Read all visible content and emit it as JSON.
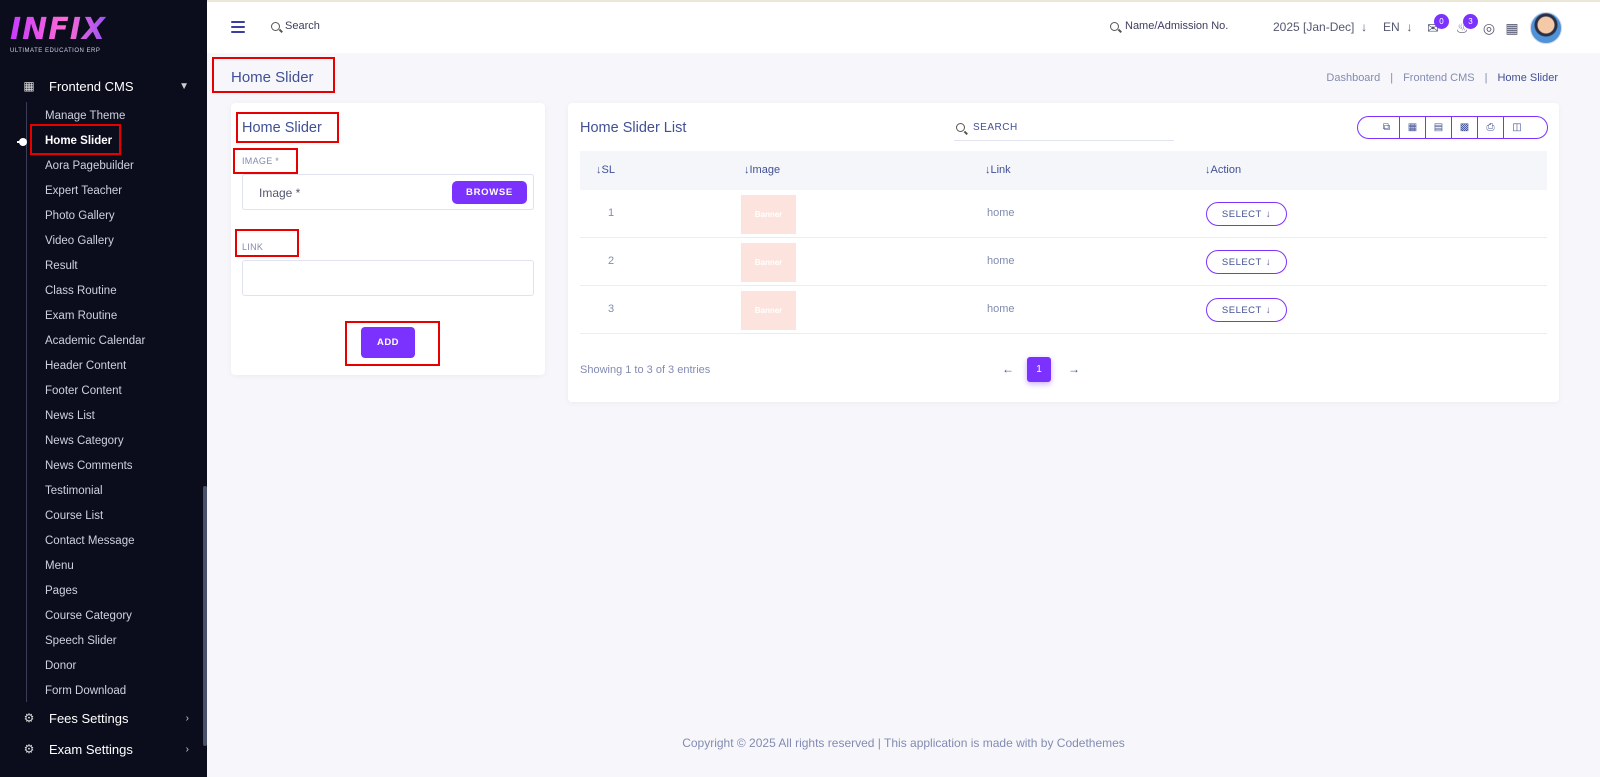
{
  "brand": {
    "logo_text": "INFIX",
    "tagline": "ULTIMATE EDUCATION ERP"
  },
  "sidebar": {
    "section": {
      "label": "Frontend CMS",
      "icon": "building-icon"
    },
    "items": [
      "Manage Theme",
      "Home Slider",
      "Aora Pagebuilder",
      "Expert Teacher",
      "Photo Gallery",
      "Video Gallery",
      "Result",
      "Class Routine",
      "Exam Routine",
      "Academic Calendar",
      "Header Content",
      "Footer Content",
      "News List",
      "News Category",
      "News Comments",
      "Testimonial",
      "Course List",
      "Contact Message",
      "Menu",
      "Pages",
      "Course Category",
      "Speech Slider",
      "Donor",
      "Form Download"
    ],
    "active_index": 1,
    "other_sections": [
      {
        "label": "Fees Settings",
        "icon": "gears-icon"
      },
      {
        "label": "Exam Settings",
        "icon": "gears-icon"
      }
    ]
  },
  "header": {
    "search_label": "Search",
    "student_search_label": "Name/Admission No.",
    "academic_year": "2025 [Jan-Dec]",
    "language": "EN",
    "messages_count": "0",
    "notifications_count": "3"
  },
  "page": {
    "title": "Home Slider",
    "breadcrumb": [
      "Dashboard",
      "Frontend CMS",
      "Home Slider"
    ]
  },
  "form": {
    "title": "Home Slider",
    "image_label": "IMAGE *",
    "image_placeholder": "Image *",
    "browse_label": "BROWSE",
    "link_label": "LINK",
    "link_value": "",
    "add_label": "ADD"
  },
  "list": {
    "title": "Home Slider List",
    "search_placeholder": "SEARCH",
    "columns": [
      "SL",
      "Image",
      "Link",
      "Action"
    ],
    "rows": [
      {
        "sl": "1",
        "image": "Banner",
        "link": "home",
        "action": "SELECT"
      },
      {
        "sl": "2",
        "image": "Banner",
        "link": "home",
        "action": "SELECT"
      },
      {
        "sl": "3",
        "image": "Banner",
        "link": "home",
        "action": "SELECT"
      }
    ],
    "showing": "Showing 1 to 3 of 3 entries",
    "current_page": "1"
  },
  "footer": {
    "text": "Copyright © 2025 All rights reserved | This application is made with by Codethemes"
  },
  "colors": {
    "accent": "#7c32ff",
    "sidebar_bg": "#0b0d1c",
    "text_primary": "#415094",
    "text_muted": "#828bb2",
    "highlight": "#e60000"
  }
}
